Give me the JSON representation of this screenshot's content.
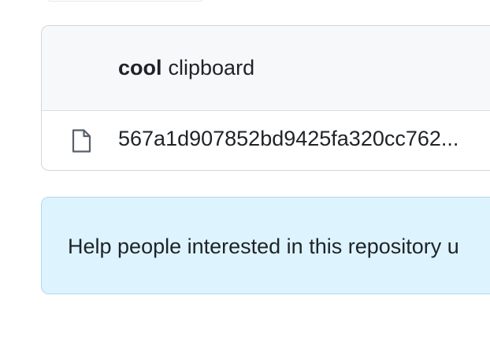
{
  "latest_commit": {
    "author": "cool",
    "message": "clipboard"
  },
  "files": [
    {
      "icon": "file-icon",
      "name": "567a1d907852bd9425fa320cc762..."
    }
  ],
  "readme_prompt": {
    "text": "Help people interested in this repository u"
  }
}
